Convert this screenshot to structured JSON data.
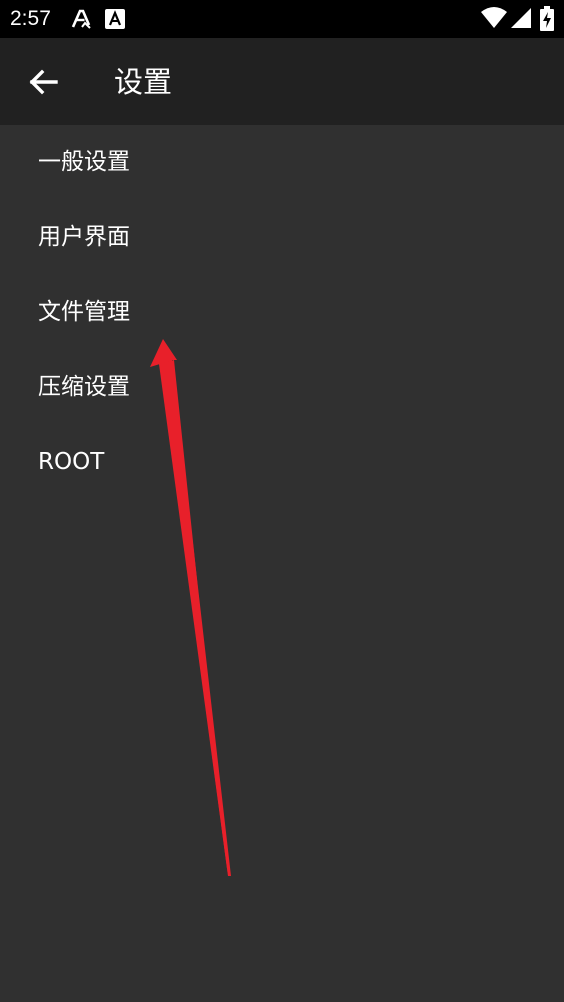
{
  "status_bar": {
    "time": "2:57",
    "icons": [
      "font-a-icon",
      "font-app-icon",
      "wifi-icon",
      "signal-icon",
      "battery-charging-icon"
    ]
  },
  "app_bar": {
    "title": "设置",
    "back_icon": "arrow-back-icon",
    "background": "#212121"
  },
  "settings": {
    "items": [
      {
        "label": "一般设置"
      },
      {
        "label": "用户界面"
      },
      {
        "label": "文件管理"
      },
      {
        "label": "压缩设置"
      },
      {
        "label": "ROOT"
      }
    ]
  },
  "colors": {
    "background": "#303030",
    "status_bar": "#000000",
    "text": "#ffffff",
    "annotation_arrow": "#e8202a"
  }
}
